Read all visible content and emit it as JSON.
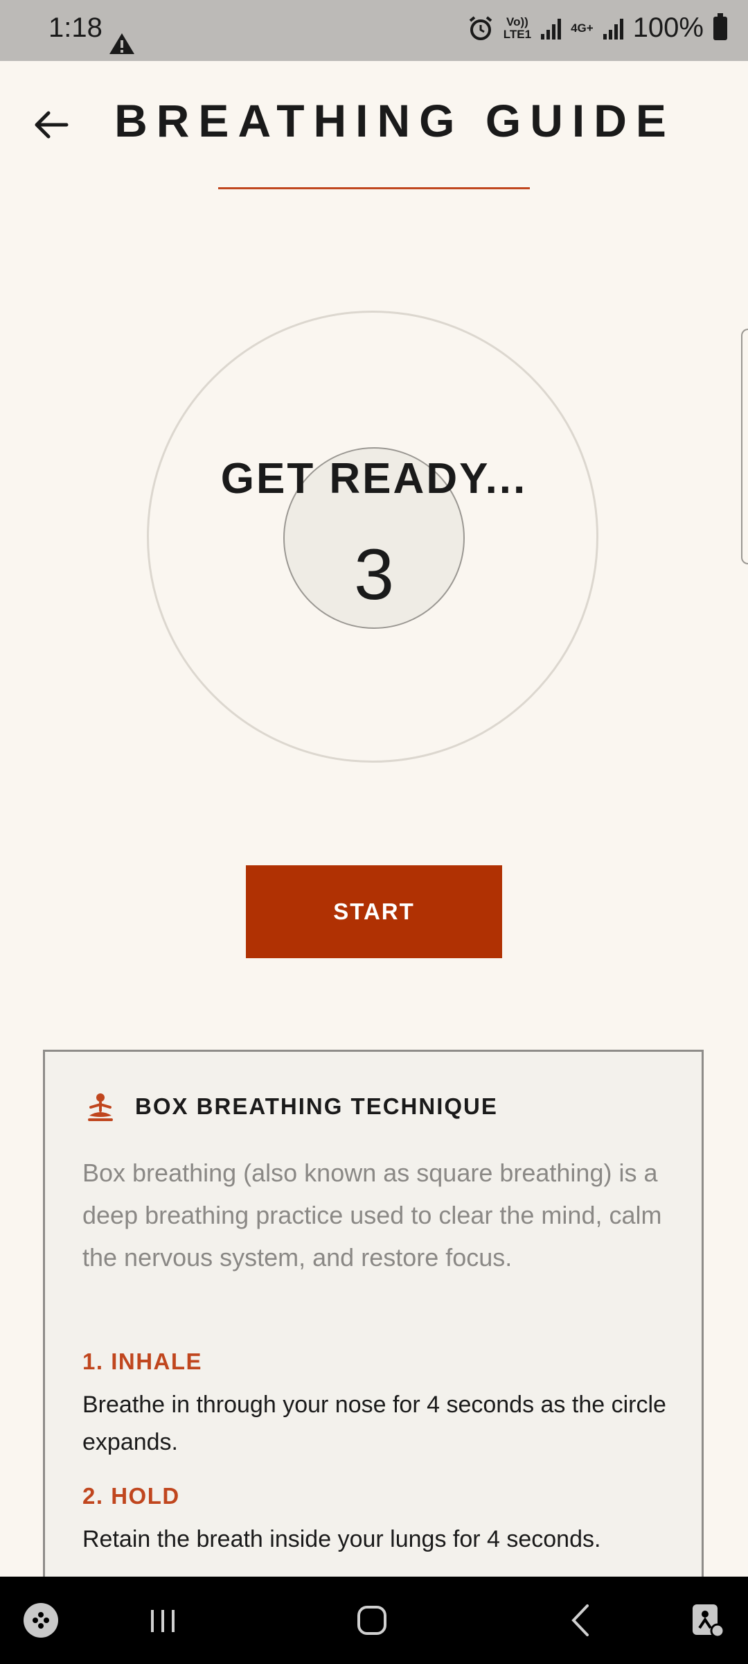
{
  "status_bar": {
    "time": "1:18",
    "volte_label": "Vo))",
    "lte_label": "LTE1",
    "network_label": "4G+",
    "battery_label": "100%"
  },
  "header": {
    "title": "BREATHING GUIDE"
  },
  "breathing": {
    "prompt": "GET READY...",
    "countdown": "3"
  },
  "start_button": {
    "label": "START"
  },
  "info_card": {
    "title": "BOX BREATHING TECHNIQUE",
    "description": "Box breathing (also known as square breathing) is a deep breathing practice used to clear the mind, calm the nervous system, and restore focus.",
    "steps": [
      {
        "title": "1. INHALE",
        "body": "Breathe in through your nose for 4 seconds as the circle expands."
      },
      {
        "title": "2. HOLD",
        "body": "Retain the breath inside your lungs for 4 seconds."
      }
    ]
  },
  "colors": {
    "accent": "#c0461e",
    "button": "#b03103",
    "background": "#faf6f0",
    "card": "#f3f1ec"
  },
  "icons": [
    "back-arrow-icon",
    "meditation-icon",
    "warning-icon",
    "alarm-icon",
    "signal-icon",
    "battery-icon",
    "game-launcher-icon",
    "recents-icon",
    "home-icon",
    "back-nav-icon",
    "accessibility-icon"
  ]
}
